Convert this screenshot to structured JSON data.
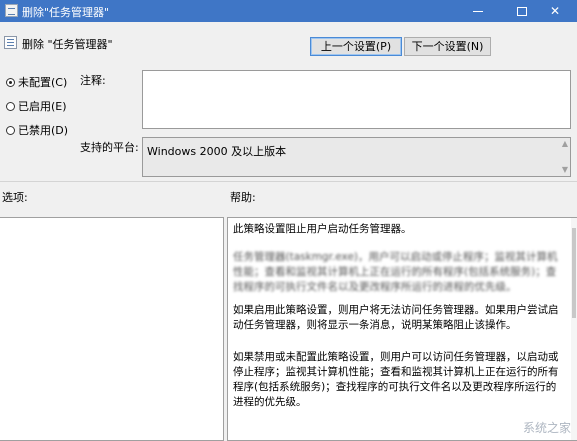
{
  "window": {
    "title": "删除\"任务管理器\"",
    "minimize_glyph": "—",
    "maximize_glyph": "☐",
    "close_glyph": "✕"
  },
  "policy": {
    "name": "删除 \"任务管理器\""
  },
  "nav": {
    "prev_label": "上一个设置(P)",
    "next_label": "下一个设置(N)"
  },
  "state_options": [
    {
      "label": "未配置(C)",
      "checked": true
    },
    {
      "label": "已启用(E)",
      "checked": false
    },
    {
      "label": "已禁用(D)",
      "checked": false
    }
  ],
  "comment": {
    "label": "注释:",
    "value": ""
  },
  "platform": {
    "label": "支持的平台:",
    "value": "Windows 2000 及以上版本"
  },
  "options": {
    "label": "选项:"
  },
  "help": {
    "label": "帮助:",
    "paragraphs": [
      "此策略设置阻止用户启动任务管理器。",
      "任务管理器(taskmgr.exe)，用户可以启动或停止程序；监视其计算机性能；查看和监视其计算机上正在运行的所有程序(包括系统服务)；查找程序的可执行文件名以及更改程序所运行的进程的优先级。",
      "如果启用此策略设置，则用户将无法访问任务管理器。如果用户尝试启动任务管理器，则将显示一条消息，说明某策略阻止该操作。",
      "如果禁用或未配置此策略设置，则用户可以访问任务管理器，以启动或停止程序；监视其计算机性能；查看和监视其计算机上正在运行的所有程序(包括系统服务)；查找程序的可执行文件名以及更改程序所运行的进程的优先级。"
    ]
  },
  "watermark": "系统之家"
}
